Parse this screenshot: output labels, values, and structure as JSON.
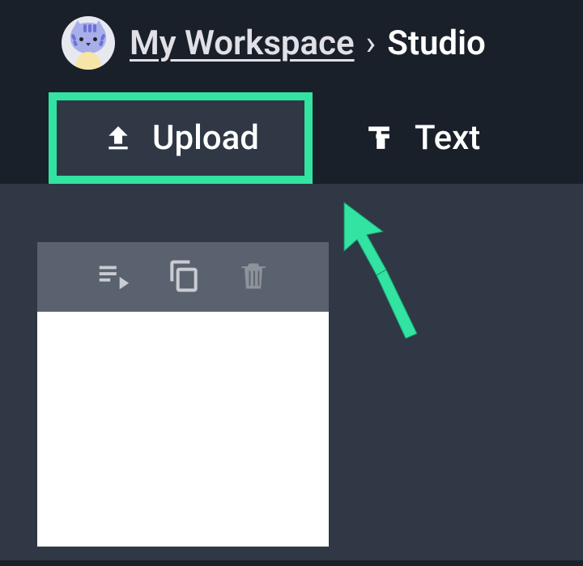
{
  "breadcrumb": {
    "workspace_label": "My Workspace",
    "separator": "›",
    "current": "Studio"
  },
  "tabs": {
    "upload_label": "Upload",
    "text_label": "Text"
  },
  "icons": {
    "avatar": "cat-avatar",
    "upload": "upload-icon",
    "text": "text-format-icon",
    "queue": "playlist-play-icon",
    "copy": "copy-icon",
    "delete": "trash-icon",
    "annotation_arrow": "cursor-arrow-icon"
  }
}
